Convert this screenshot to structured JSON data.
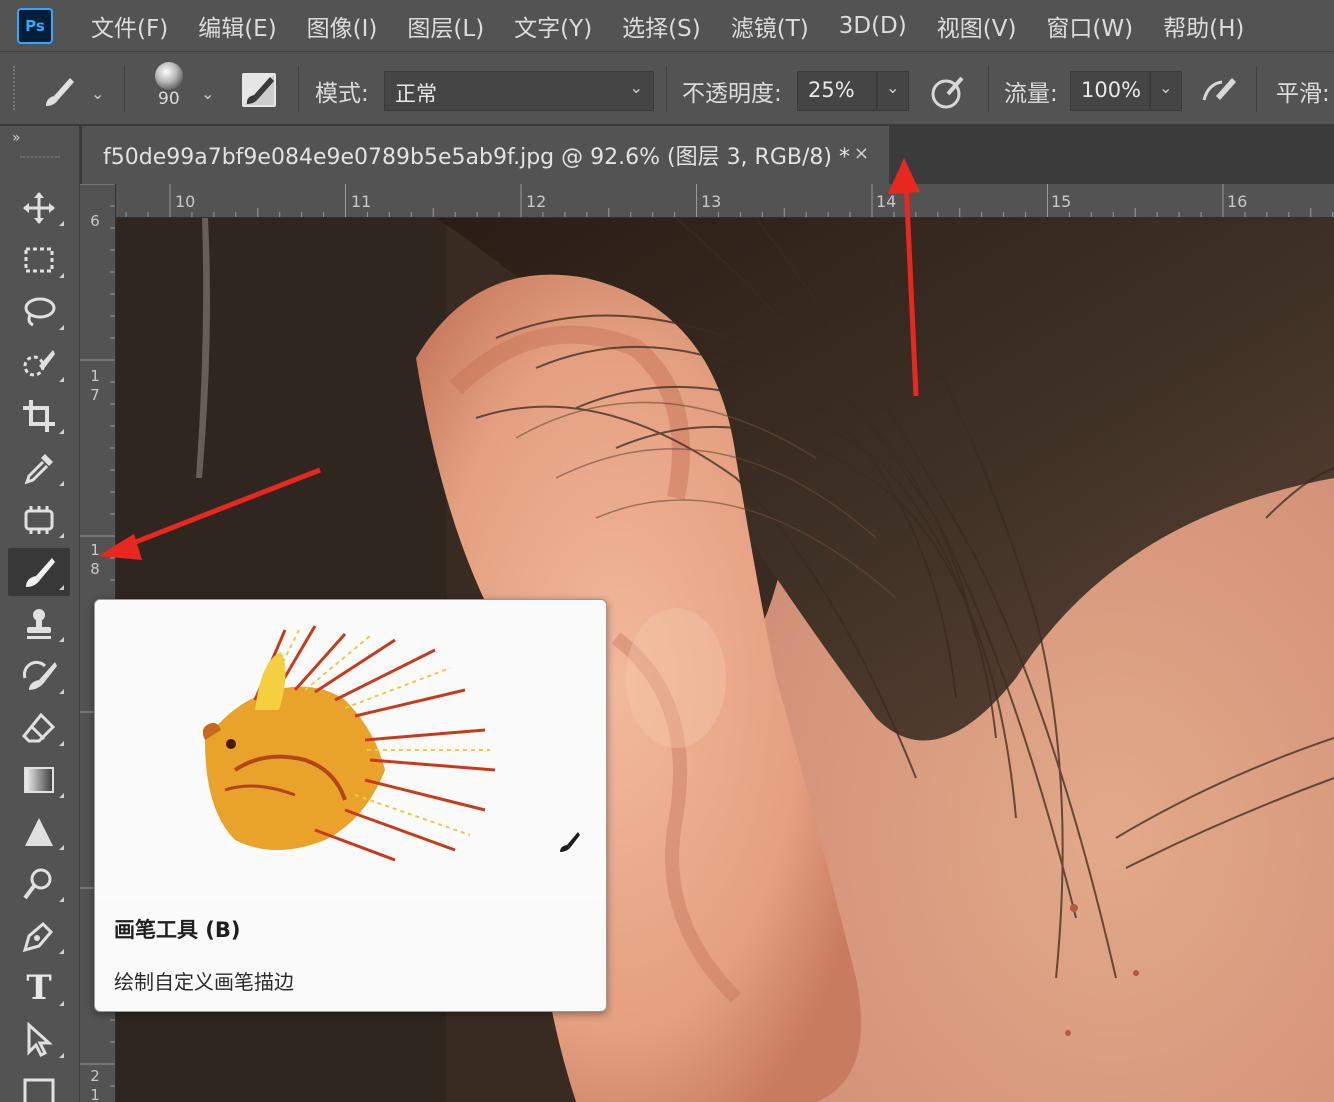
{
  "app": {
    "logo_text": "Ps",
    "menu": [
      "文件(F)",
      "编辑(E)",
      "图像(I)",
      "图层(L)",
      "文字(Y)",
      "选择(S)",
      "滤镜(T)",
      "3D(D)",
      "视图(V)",
      "窗口(W)",
      "帮助(H)"
    ]
  },
  "options": {
    "brush_size": "90",
    "mode_label": "模式:",
    "mode_value": "正常",
    "opacity_label": "不透明度:",
    "opacity_value": "25%",
    "flow_label": "流量:",
    "flow_value": "100%",
    "smoothing_label": "平滑:"
  },
  "document": {
    "tab_title": "f50de99a7bf9e084e9e0789b5e5ab9f.jpg @ 92.6% (图层 3, RGB/8) *",
    "close_label": "×"
  },
  "rulers": {
    "horizontal": [
      "10",
      "11",
      "12",
      "13",
      "14",
      "15",
      "16"
    ],
    "vertical": [
      {
        "digits": [
          "6"
        ]
      },
      {
        "digits": [
          "1",
          "7"
        ]
      },
      {
        "digits": [
          "1",
          "8"
        ]
      },
      {
        "digits": [
          "2",
          "1"
        ]
      }
    ]
  },
  "toolbar": {
    "collapse_label": "»",
    "tools": [
      {
        "name": "move-tool",
        "icon": "move-icon"
      },
      {
        "name": "marquee-tool",
        "icon": "rect-marquee-icon"
      },
      {
        "name": "lasso-tool",
        "icon": "lasso-icon"
      },
      {
        "name": "quick-select-tool",
        "icon": "quick-select-icon"
      },
      {
        "name": "crop-tool",
        "icon": "crop-icon"
      },
      {
        "name": "eyedropper-tool",
        "icon": "eyedropper-icon"
      },
      {
        "name": "healing-brush-tool",
        "icon": "patch-icon"
      },
      {
        "name": "brush-tool",
        "icon": "brush-icon",
        "active": true
      },
      {
        "name": "clone-stamp-tool",
        "icon": "stamp-icon"
      },
      {
        "name": "history-brush-tool",
        "icon": "history-brush-icon"
      },
      {
        "name": "eraser-tool",
        "icon": "eraser-icon"
      },
      {
        "name": "gradient-tool",
        "icon": "gradient-icon"
      },
      {
        "name": "sharpen-tool",
        "icon": "triangle-icon"
      },
      {
        "name": "dodge-tool",
        "icon": "dodge-icon"
      },
      {
        "name": "pen-tool",
        "icon": "pen-icon"
      },
      {
        "name": "type-tool",
        "icon": "type-icon"
      },
      {
        "name": "path-select-tool",
        "icon": "arrow-cursor-icon"
      },
      {
        "name": "shape-tool",
        "icon": "rectangle-icon"
      }
    ],
    "type_glyph": "T"
  },
  "tooltip": {
    "title": "画笔工具 (B)",
    "description": "绘制自定义画笔描边"
  },
  "colors": {
    "panel": "#535353",
    "accent_ps": "#31a8ff",
    "annotation_arrow": "#e8281e"
  }
}
